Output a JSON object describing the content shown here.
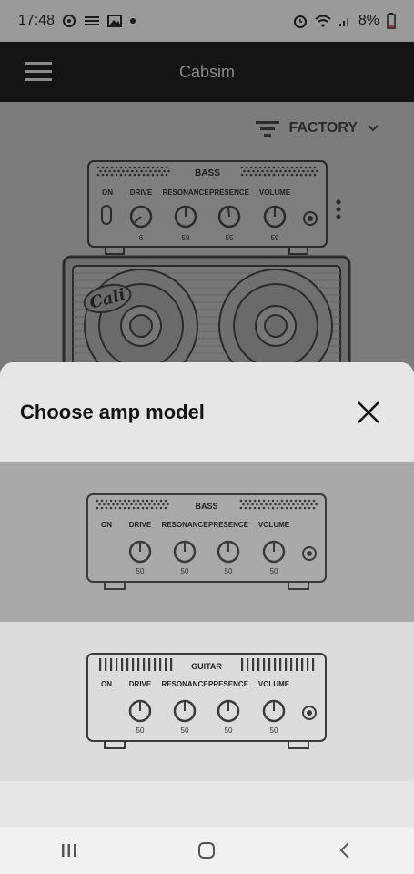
{
  "status_bar": {
    "time": "17:48",
    "battery": "8%",
    "icons": [
      "sync-icon",
      "notification-icon",
      "image-icon",
      "dot-icon",
      "alarm-icon",
      "wifi-icon",
      "signal-icon",
      "battery-icon"
    ]
  },
  "app_bar": {
    "title": "Cabsim",
    "menu_icon": "hamburger-icon"
  },
  "background": {
    "preset_label": "FACTORY",
    "current_amp": {
      "name": "BASS",
      "labels": [
        "ON",
        "DRIVE",
        "RESONANCE",
        "PRESENCE",
        "VOLUME"
      ],
      "values": [
        "6",
        "59",
        "55",
        "59"
      ]
    },
    "cabinet_logo": "Cali"
  },
  "sheet": {
    "title": "Choose amp model",
    "options": [
      {
        "name": "BASS",
        "selected": true,
        "labels": [
          "ON",
          "DRIVE",
          "RESONANCE",
          "PRESENCE",
          "VOLUME"
        ],
        "values": [
          "50",
          "50",
          "50",
          "50"
        ]
      },
      {
        "name": "GUITAR",
        "selected": false,
        "labels": [
          "ON",
          "DRIVE",
          "RESONANCE",
          "PRESENCE",
          "VOLUME"
        ],
        "values": [
          "50",
          "50",
          "50",
          "50"
        ]
      }
    ]
  },
  "colors": {
    "app_bar": "#141414",
    "sheet": "#e6e6e6",
    "selected_option": "#a9a9a9",
    "nav_bar": "#f1f1f1"
  }
}
